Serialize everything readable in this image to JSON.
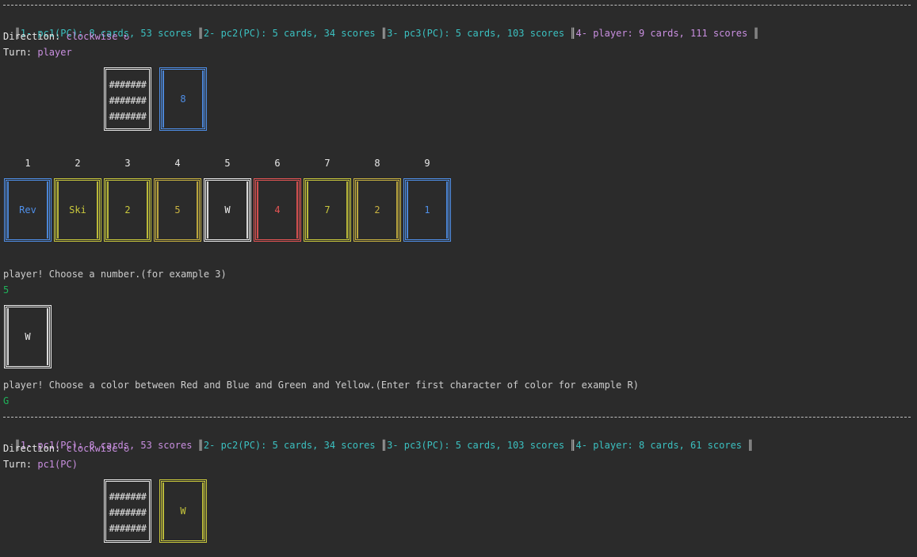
{
  "round1": {
    "status": [
      {
        "label": "1- pc1(PC): 8 cards, 53 scores ",
        "color": "teal"
      },
      {
        "label": "2- pc2(PC): 5 cards, 34 scores ",
        "color": "teal"
      },
      {
        "label": "3- pc3(PC): 5 cards, 103 scores ",
        "color": "teal"
      },
      {
        "label": "4- player: 9 cards, 111 scores ",
        "color": "purple"
      }
    ],
    "direction_label": "Direction: ",
    "direction_value": "clockwise ↻",
    "turn_label": "Turn: ",
    "turn_value": "player",
    "deck_hash": "#######",
    "top_card": {
      "value": "8",
      "color": "blue"
    },
    "hand_numbers": [
      "1",
      "2",
      "3",
      "4",
      "5",
      "6",
      "7",
      "8",
      "9"
    ],
    "hand": [
      {
        "value": "Rev",
        "color": "blue"
      },
      {
        "value": "Ski",
        "color": "yellow"
      },
      {
        "value": "2",
        "color": "yellow"
      },
      {
        "value": "5",
        "color": "olive"
      },
      {
        "value": "W",
        "color": "white"
      },
      {
        "value": "4",
        "color": "red"
      },
      {
        "value": "7",
        "color": "yellow"
      },
      {
        "value": "2",
        "color": "olive"
      },
      {
        "value": "1",
        "color": "blue"
      }
    ],
    "prompt_number": "player! Choose a number.(for example 3)",
    "input_number": "5",
    "chosen_card": {
      "value": "W",
      "color": "white"
    },
    "prompt_color": "player! Choose a color between Red and Blue and Green and Yellow.(Enter first character of color for example R)",
    "input_color": "G"
  },
  "round2": {
    "status": [
      {
        "label": "1- pc1(PC): 8 cards, 53 scores ",
        "color": "purple"
      },
      {
        "label": "2- pc2(PC): 5 cards, 34 scores ",
        "color": "teal"
      },
      {
        "label": "3- pc3(PC): 5 cards, 103 scores ",
        "color": "teal"
      },
      {
        "label": "4- player: 8 cards, 61 scores ",
        "color": "teal"
      }
    ],
    "direction_label": "Direction: ",
    "direction_value": "clockwise ↻",
    "turn_label": "Turn: ",
    "turn_value": "pc1(PC)",
    "deck_hash": "#######",
    "top_card": {
      "value": "W",
      "color": "yellow"
    }
  },
  "colors": {
    "background": "#2b2b2b",
    "blue": "#4f8fe8",
    "yellow": "#c9c83c",
    "red": "#e45454",
    "teal": "#3bc0c0",
    "purple": "#c98fe0",
    "input_green": "#1fb35a"
  }
}
